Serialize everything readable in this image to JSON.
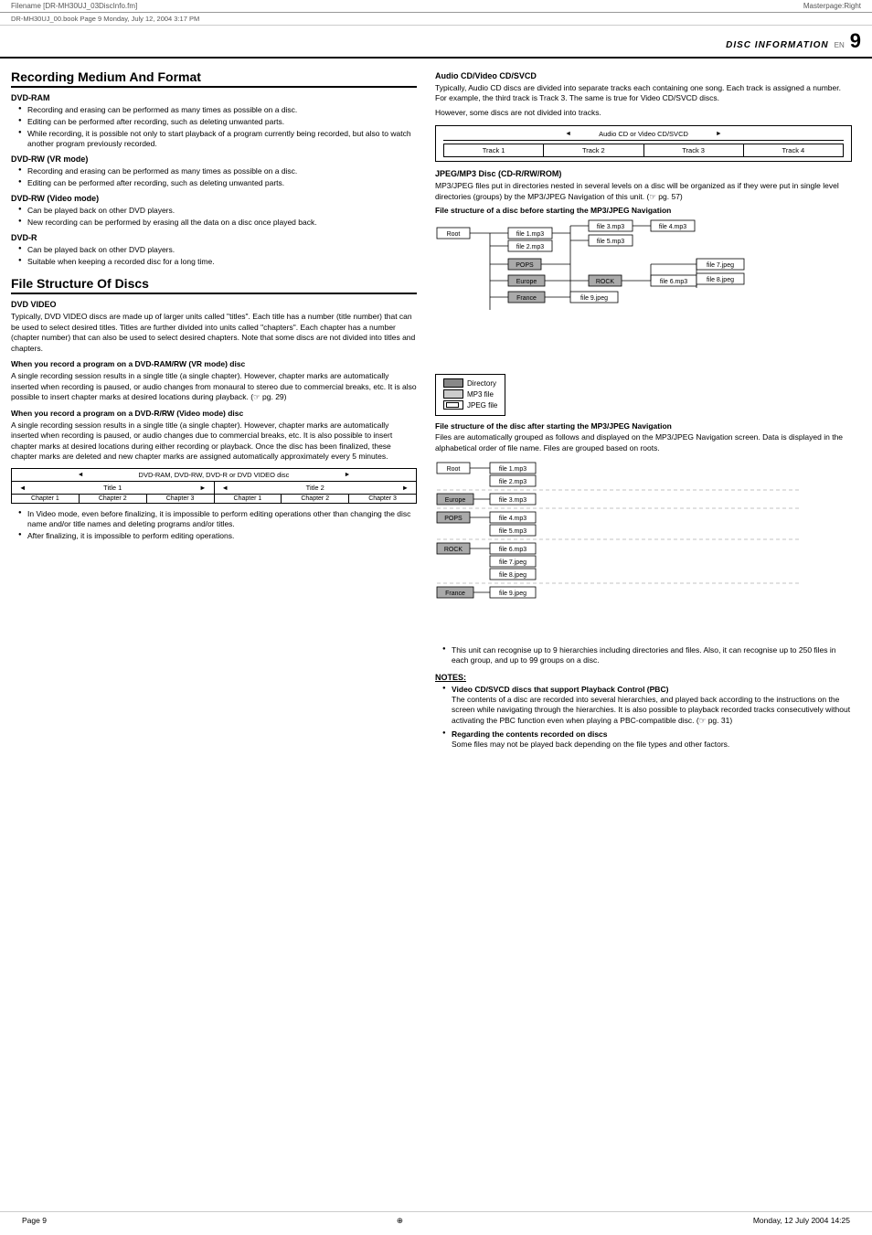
{
  "header": {
    "filename": "Filename [DR-MH30UJ_03DiscInfo.fm]",
    "subheader": "DR-MH30UJ_00.book  Page 9  Monday, July 12, 2004  3:17 PM",
    "masterpage": "Masterpage:Right"
  },
  "page_header": {
    "disc_info": "DISC INFORMATION",
    "en": "EN",
    "page_num": "9"
  },
  "left": {
    "section1_title": "Recording Medium And Format",
    "dvd_ram_title": "DVD-RAM",
    "dvd_ram_bullets": [
      "Recording and erasing can be performed as many times as possible on a disc.",
      "Editing can be performed after recording, such as deleting unwanted parts.",
      "While recording, it is possible not only to start playback of a program currently being recorded, but also to watch another program previously recorded."
    ],
    "dvd_rw_vr_title": "DVD-RW (VR mode)",
    "dvd_rw_vr_bullets": [
      "Recording and erasing can be performed as many times as possible on a disc.",
      "Editing can be performed after recording, such as deleting unwanted parts."
    ],
    "dvd_rw_video_title": "DVD-RW (Video mode)",
    "dvd_rw_video_bullets": [
      "Can be played back on other DVD players.",
      "New recording can be performed by erasing all the data on a disc once played back."
    ],
    "dvd_r_title": "DVD-R",
    "dvd_r_bullets": [
      "Can be played back on other DVD players.",
      "Suitable when keeping a recorded disc for a long time."
    ],
    "section2_title": "File Structure Of Discs",
    "dvd_video_title": "DVD VIDEO",
    "dvd_video_text": "Typically, DVD VIDEO discs are made up of larger units called \"titles\". Each title has a number (title number) that can be used to select desired titles. Titles are further divided into units called \"chapters\". Each chapter has a number (chapter number) that can also be used to select desired chapters. Note that some discs are not divided into titles and chapters.",
    "when_dvd_ram_title": "When you record a program on a DVD-RAM/RW (VR mode) disc",
    "when_dvd_ram_text": "A single recording session results in a single title (a single chapter). However, chapter marks are automatically inserted when recording is paused, or audio changes from monaural to stereo due to commercial breaks, etc. It is also possible to insert chapter marks at desired locations during playback. (☞ pg. 29)",
    "when_dvdr_title": "When you record a program on a DVD-R/RW (Video mode) disc",
    "when_dvdr_text": "A single recording session results in a single title (a single chapter). However, chapter marks are automatically inserted when recording is paused, or audio changes due to commercial breaks, etc. It is also possible to insert chapter marks at desired locations during either recording or playback. Once the disc has been finalized, these chapter marks are deleted and new chapter marks are assigned automatically approximately every 5 minutes.",
    "dvd_diagram_label": "DVD-RAM, DVD-RW, DVD-R or DVD VIDEO disc",
    "title1": "Title 1",
    "title2": "Title 2",
    "chapter1a": "Chapter 1",
    "chapter2a": "Chapter 2",
    "chapter3a": "Chapter 3",
    "chapter1b": "Chapter 1",
    "chapter2b": "Chapter 2",
    "chapter3b": "Chapter 3",
    "bottom_bullets": [
      "In Video mode, even before finalizing, it is impossible to perform editing operations other than changing the disc name and/or title names and deleting programs and/or titles.",
      "After finalizing, it is impossible to perform editing operations."
    ]
  },
  "right": {
    "audio_cd_title": "Audio CD/Video CD/SVCD",
    "audio_cd_text1": "Typically, Audio CD discs are divided into separate tracks each containing one song. Each track is assigned a number. For example, the third track is Track 3. The same is true for Video CD/SVCD discs.",
    "audio_cd_text2": "However, some discs are not divided into tracks.",
    "audio_cd_diagram_label": "Audio CD or Video CD/SVCD",
    "track1": "Track 1",
    "track2": "Track 2",
    "track3": "Track 3",
    "track4": "Track 4",
    "jpeg_title": "JPEG/MP3 Disc (CD-R/RW/ROM)",
    "jpeg_text": "MP3/JPEG files put in directories nested in several levels on a disc will be organized as if they were put in single level directories (groups) by the MP3/JPEG Navigation of this unit. (☞ pg. 57)",
    "file_struct_before_title": "File structure of a disc before starting the MP3/JPEG Navigation",
    "tree1_nodes": {
      "root": "Root",
      "file1": "file 1.mp3",
      "file2": "file 2.mp3",
      "file3": "file 3.mp3",
      "file4": "file 4.mp3",
      "pops": "POPS",
      "file5": "file 5.mp3",
      "europe": "Europe",
      "rock": "ROCK",
      "file6": "file 6.mp3",
      "france": "France",
      "file9jpeg": "file 9.jpeg",
      "file7jpeg": "file 7.jpeg",
      "file8jpeg": "file 8.jpeg"
    },
    "legend_directory": "Directory",
    "legend_mp3": "MP3 file",
    "legend_jpeg": "JPEG file",
    "file_struct_after_title": "File structure of the disc after starting the MP3/JPEG Navigation",
    "file_struct_after_text": "Files are automatically grouped as follows and displayed on the MP3/JPEG Navigation screen. Data is displayed in the alphabetical order of file name. Files are grouped based on roots.",
    "tree2_nodes": {
      "root": "Root",
      "file1": "file 1.mp3",
      "file2": "file 2.mp3",
      "europe": "Europe",
      "file3": "file 3.mp3",
      "pops": "POPS",
      "file4": "file 4.mp3",
      "file5": "file 5.mp3",
      "rock": "ROCK",
      "file6": "file 6.mp3",
      "file7jpeg": "file 7.jpeg",
      "file8jpeg": "file 8.jpeg",
      "france": "France",
      "file9jpeg": "file 9.jpeg"
    },
    "bottom_bullets": [
      "This unit can recognise up to 9 hierarchies including directories and files.\n  Also, it can recognise up to 250 files in each group, and up to 99 groups on a disc."
    ],
    "notes_header": "NOTES:",
    "note1_bold": "Video CD/SVCD discs that support Playback Control (PBC)",
    "note1_text": "The contents of a disc are recorded into several hierarchies, and played back according to the instructions on the screen while navigating through the hierarchies. It is also possible to playback recorded tracks consecutively without activating the PBC function even when playing a PBC-compatible disc. (☞ pg. 31)",
    "note2_bold": "Regarding the contents recorded on discs",
    "note2_text": "Some files may not be played back depending on the file types and other factors."
  },
  "footer": {
    "page_left": "Page 9",
    "page_right": "Monday, 12 July 2004  14:25"
  }
}
